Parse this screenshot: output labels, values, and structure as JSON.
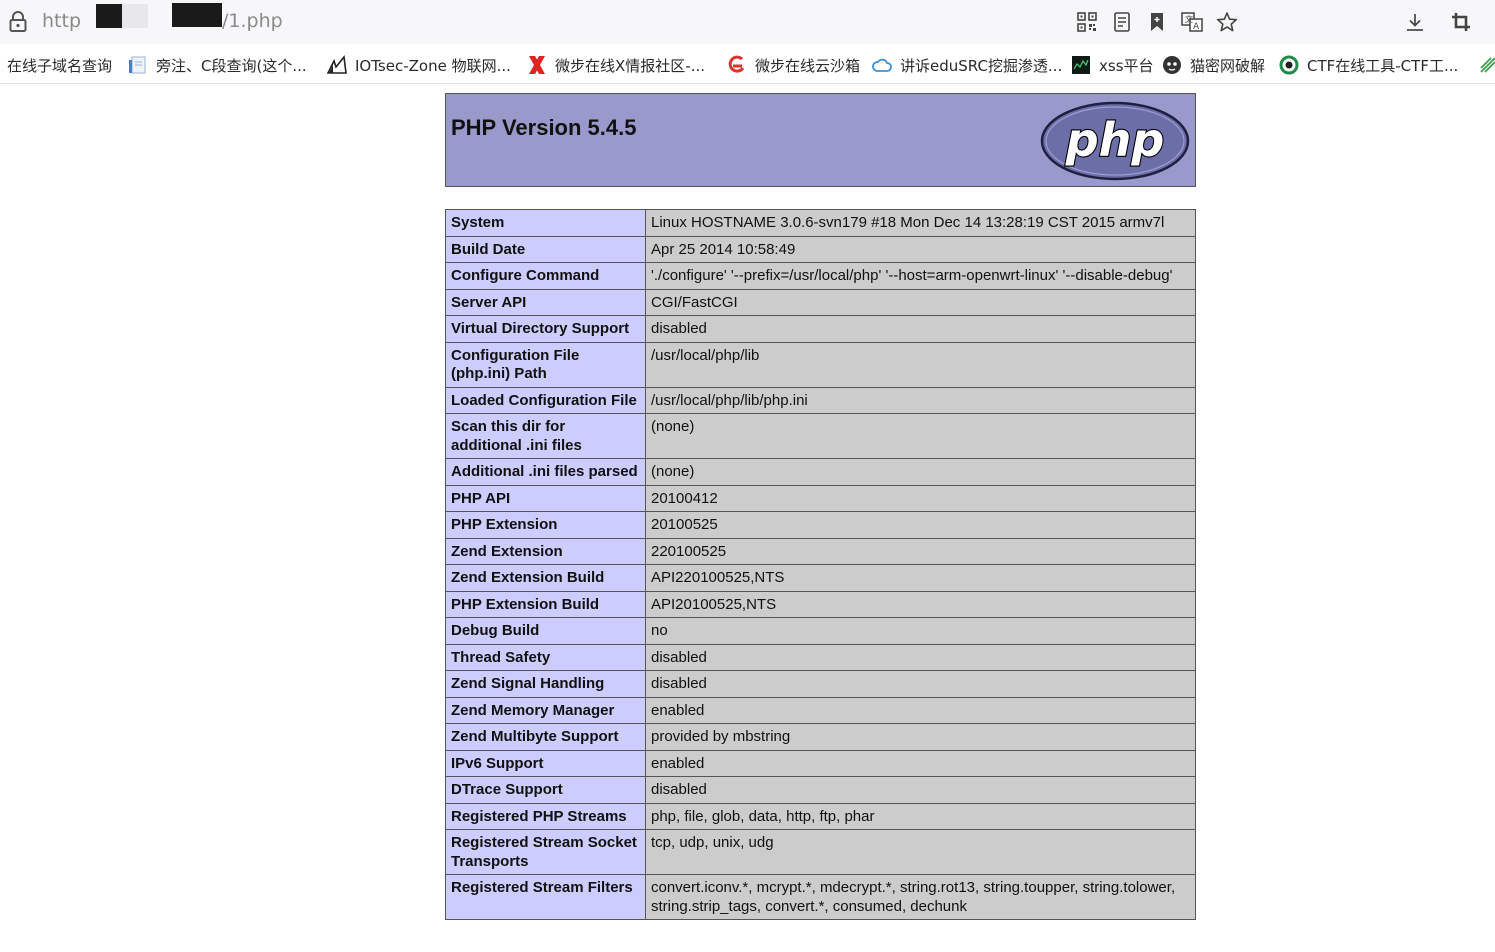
{
  "browser": {
    "url_prefix": "http",
    "url_suffix": "/1.php",
    "toolbar_icons": [
      "qr-code-icon",
      "reader-mode-icon",
      "bookmark-icon",
      "translate-icon",
      "star-icon",
      "download-icon",
      "crop-icon"
    ]
  },
  "bookmarks": [
    {
      "label": "在线子域名查询",
      "icon": "none"
    },
    {
      "label": "旁注、C段查询(这个...",
      "icon": "page-icon"
    },
    {
      "label": "IOTsec-Zone 物联网...",
      "icon": "iotsec-icon"
    },
    {
      "label": "微步在线X情报社区-...",
      "icon": "x-icon"
    },
    {
      "label": "微步在线云沙箱",
      "icon": "sandbox-icon"
    },
    {
      "label": "讲诉eduSRC挖掘渗透...",
      "icon": "cloud-icon"
    },
    {
      "label": "xss平台",
      "icon": "xss-icon"
    },
    {
      "label": "猫密网破解",
      "icon": "cat-icon"
    },
    {
      "label": "CTF在线工具-CTF工...",
      "icon": "ctf-icon"
    }
  ],
  "phpinfo": {
    "title": "PHP Version 5.4.5",
    "logo_text": "php",
    "rows": [
      {
        "key": "System",
        "value": "Linux HOSTNAME 3.0.6-svn179 #18 Mon Dec 14 13:28:19 CST 2015 armv7l"
      },
      {
        "key": "Build Date",
        "value": "Apr 25 2014 10:58:49"
      },
      {
        "key": "Configure Command",
        "value": "'./configure' '--prefix=/usr/local/php' '--host=arm-openwrt-linux' '--disable-debug'"
      },
      {
        "key": "Server API",
        "value": "CGI/FastCGI"
      },
      {
        "key": "Virtual Directory Support",
        "value": "disabled"
      },
      {
        "key": "Configuration File (php.ini) Path",
        "value": "/usr/local/php/lib"
      },
      {
        "key": "Loaded Configuration File",
        "value": "/usr/local/php/lib/php.ini"
      },
      {
        "key": "Scan this dir for additional .ini files",
        "value": "(none)"
      },
      {
        "key": "Additional .ini files parsed",
        "value": "(none)"
      },
      {
        "key": "PHP API",
        "value": "20100412"
      },
      {
        "key": "PHP Extension",
        "value": "20100525"
      },
      {
        "key": "Zend Extension",
        "value": "220100525"
      },
      {
        "key": "Zend Extension Build",
        "value": "API220100525,NTS"
      },
      {
        "key": "PHP Extension Build",
        "value": "API20100525,NTS"
      },
      {
        "key": "Debug Build",
        "value": "no"
      },
      {
        "key": "Thread Safety",
        "value": "disabled"
      },
      {
        "key": "Zend Signal Handling",
        "value": "disabled"
      },
      {
        "key": "Zend Memory Manager",
        "value": "enabled"
      },
      {
        "key": "Zend Multibyte Support",
        "value": "provided by mbstring"
      },
      {
        "key": "IPv6 Support",
        "value": "enabled"
      },
      {
        "key": "DTrace Support",
        "value": "disabled"
      },
      {
        "key": "Registered PHP Streams",
        "value": "php, file, glob, data, http, ftp, phar"
      },
      {
        "key": "Registered Stream Socket Transports",
        "value": "tcp, udp, unix, udg"
      },
      {
        "key": "Registered Stream Filters",
        "value": "convert.iconv.*, mcrypt.*, mdecrypt.*, string.rot13, string.toupper, string.tolower, string.strip_tags, convert.*, consumed, dechunk"
      }
    ]
  },
  "colors": {
    "header_bg": "#9999cc",
    "key_bg": "#ccccff",
    "value_bg": "#cccccc"
  }
}
